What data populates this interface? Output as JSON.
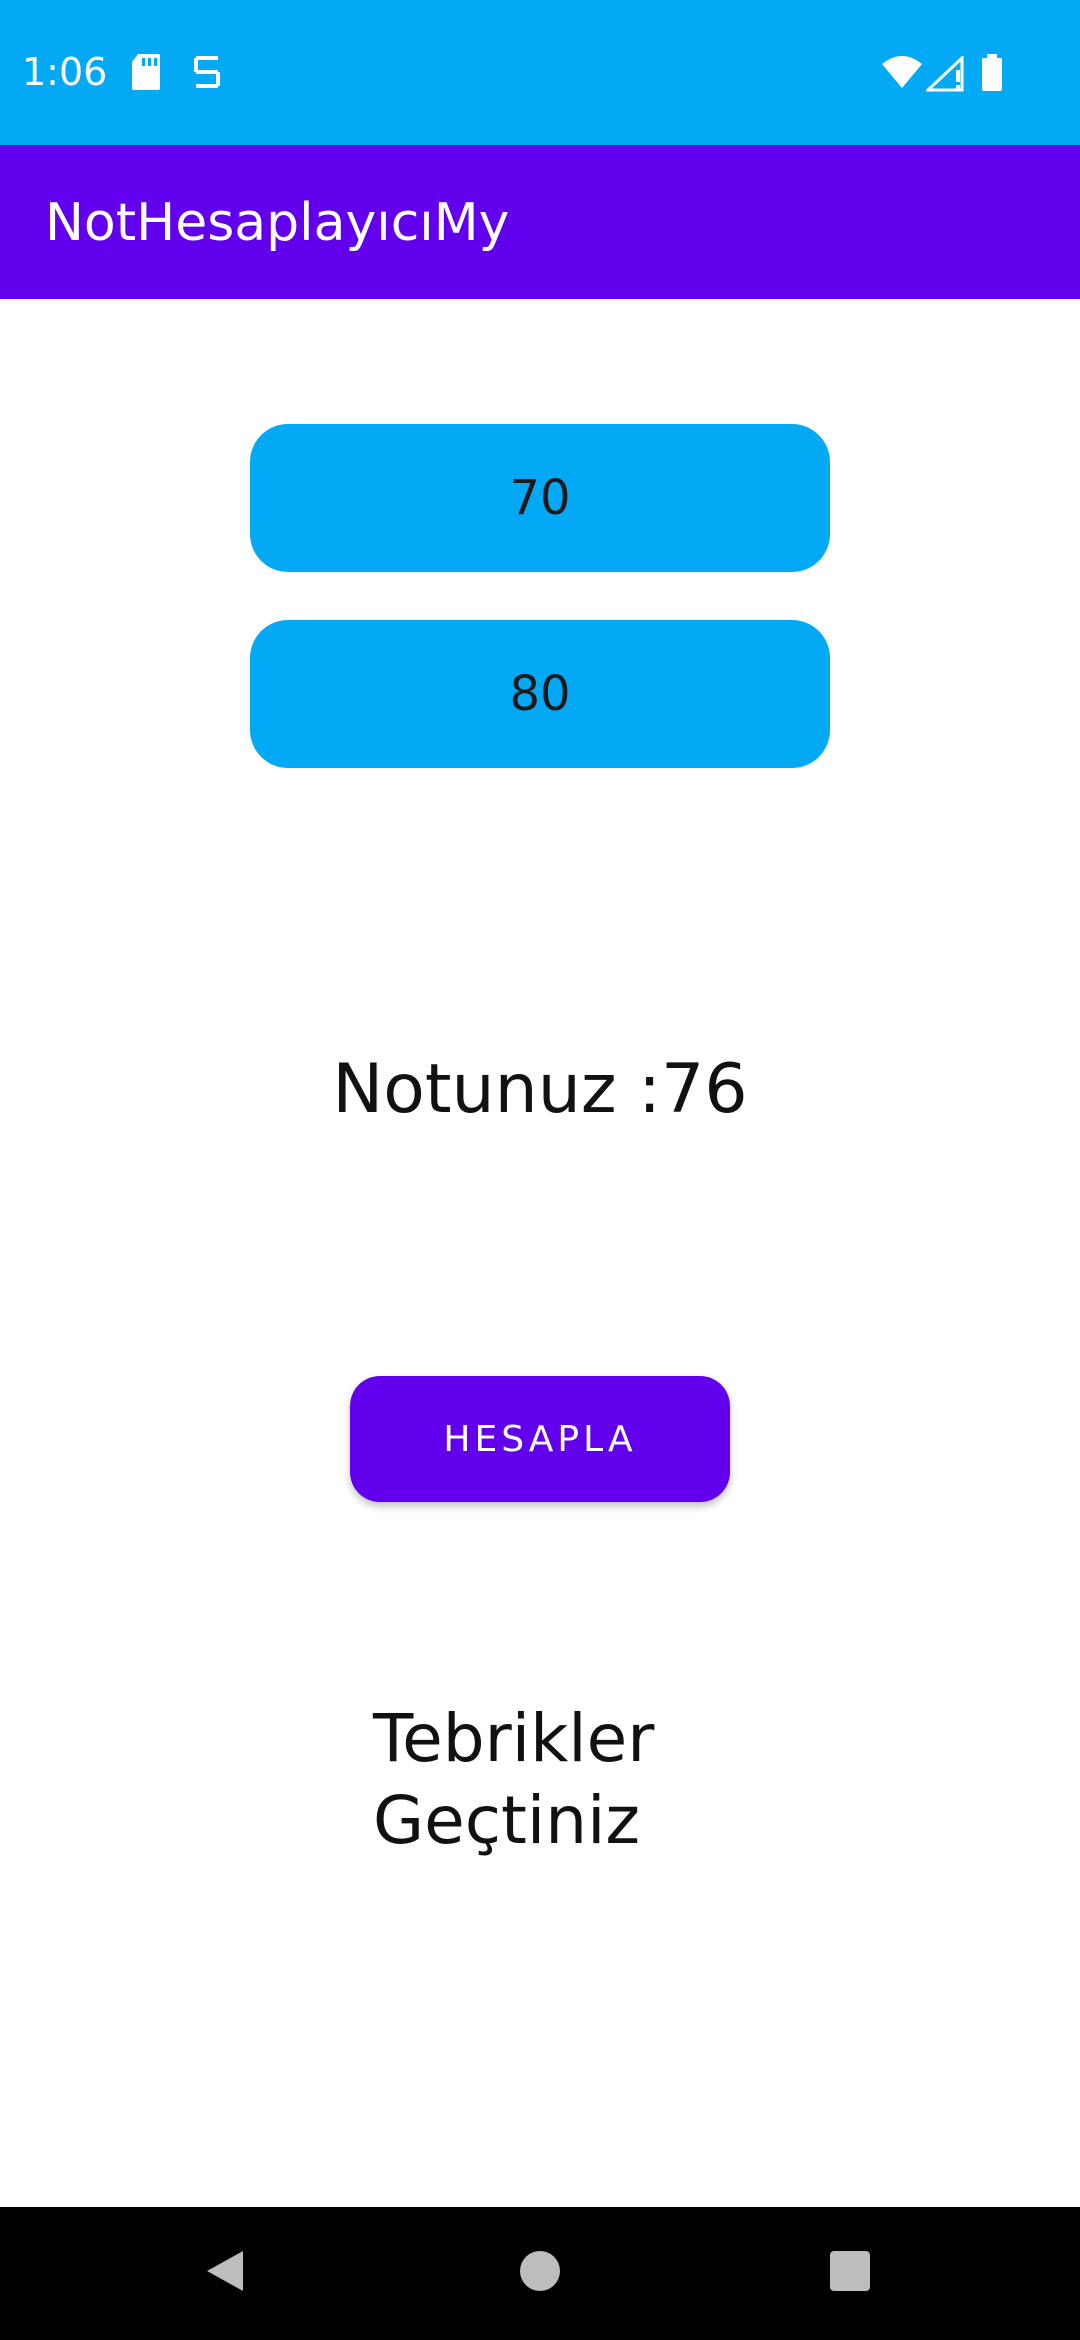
{
  "status_bar": {
    "time": "1:06",
    "icons": [
      "sd-card-icon",
      "sync-icon",
      "wifi-icon",
      "signal-icon",
      "battery-icon"
    ]
  },
  "app_bar": {
    "title": "NotHesaplayıcıMy"
  },
  "form": {
    "grade1_value": "70",
    "grade2_value": "80",
    "result": "Notunuz :76",
    "calculate_label": "HESAPLA",
    "message_line1": "Tebrikler",
    "message_line2": "Geçtiniz"
  },
  "nav_bar": {
    "icons": [
      "back-icon",
      "home-icon",
      "recents-icon"
    ]
  },
  "colors": {
    "status_bar": "#03a9f4",
    "app_bar": "#6200ee",
    "input_bg": "#03a9f4",
    "button_bg": "#6200ee"
  }
}
